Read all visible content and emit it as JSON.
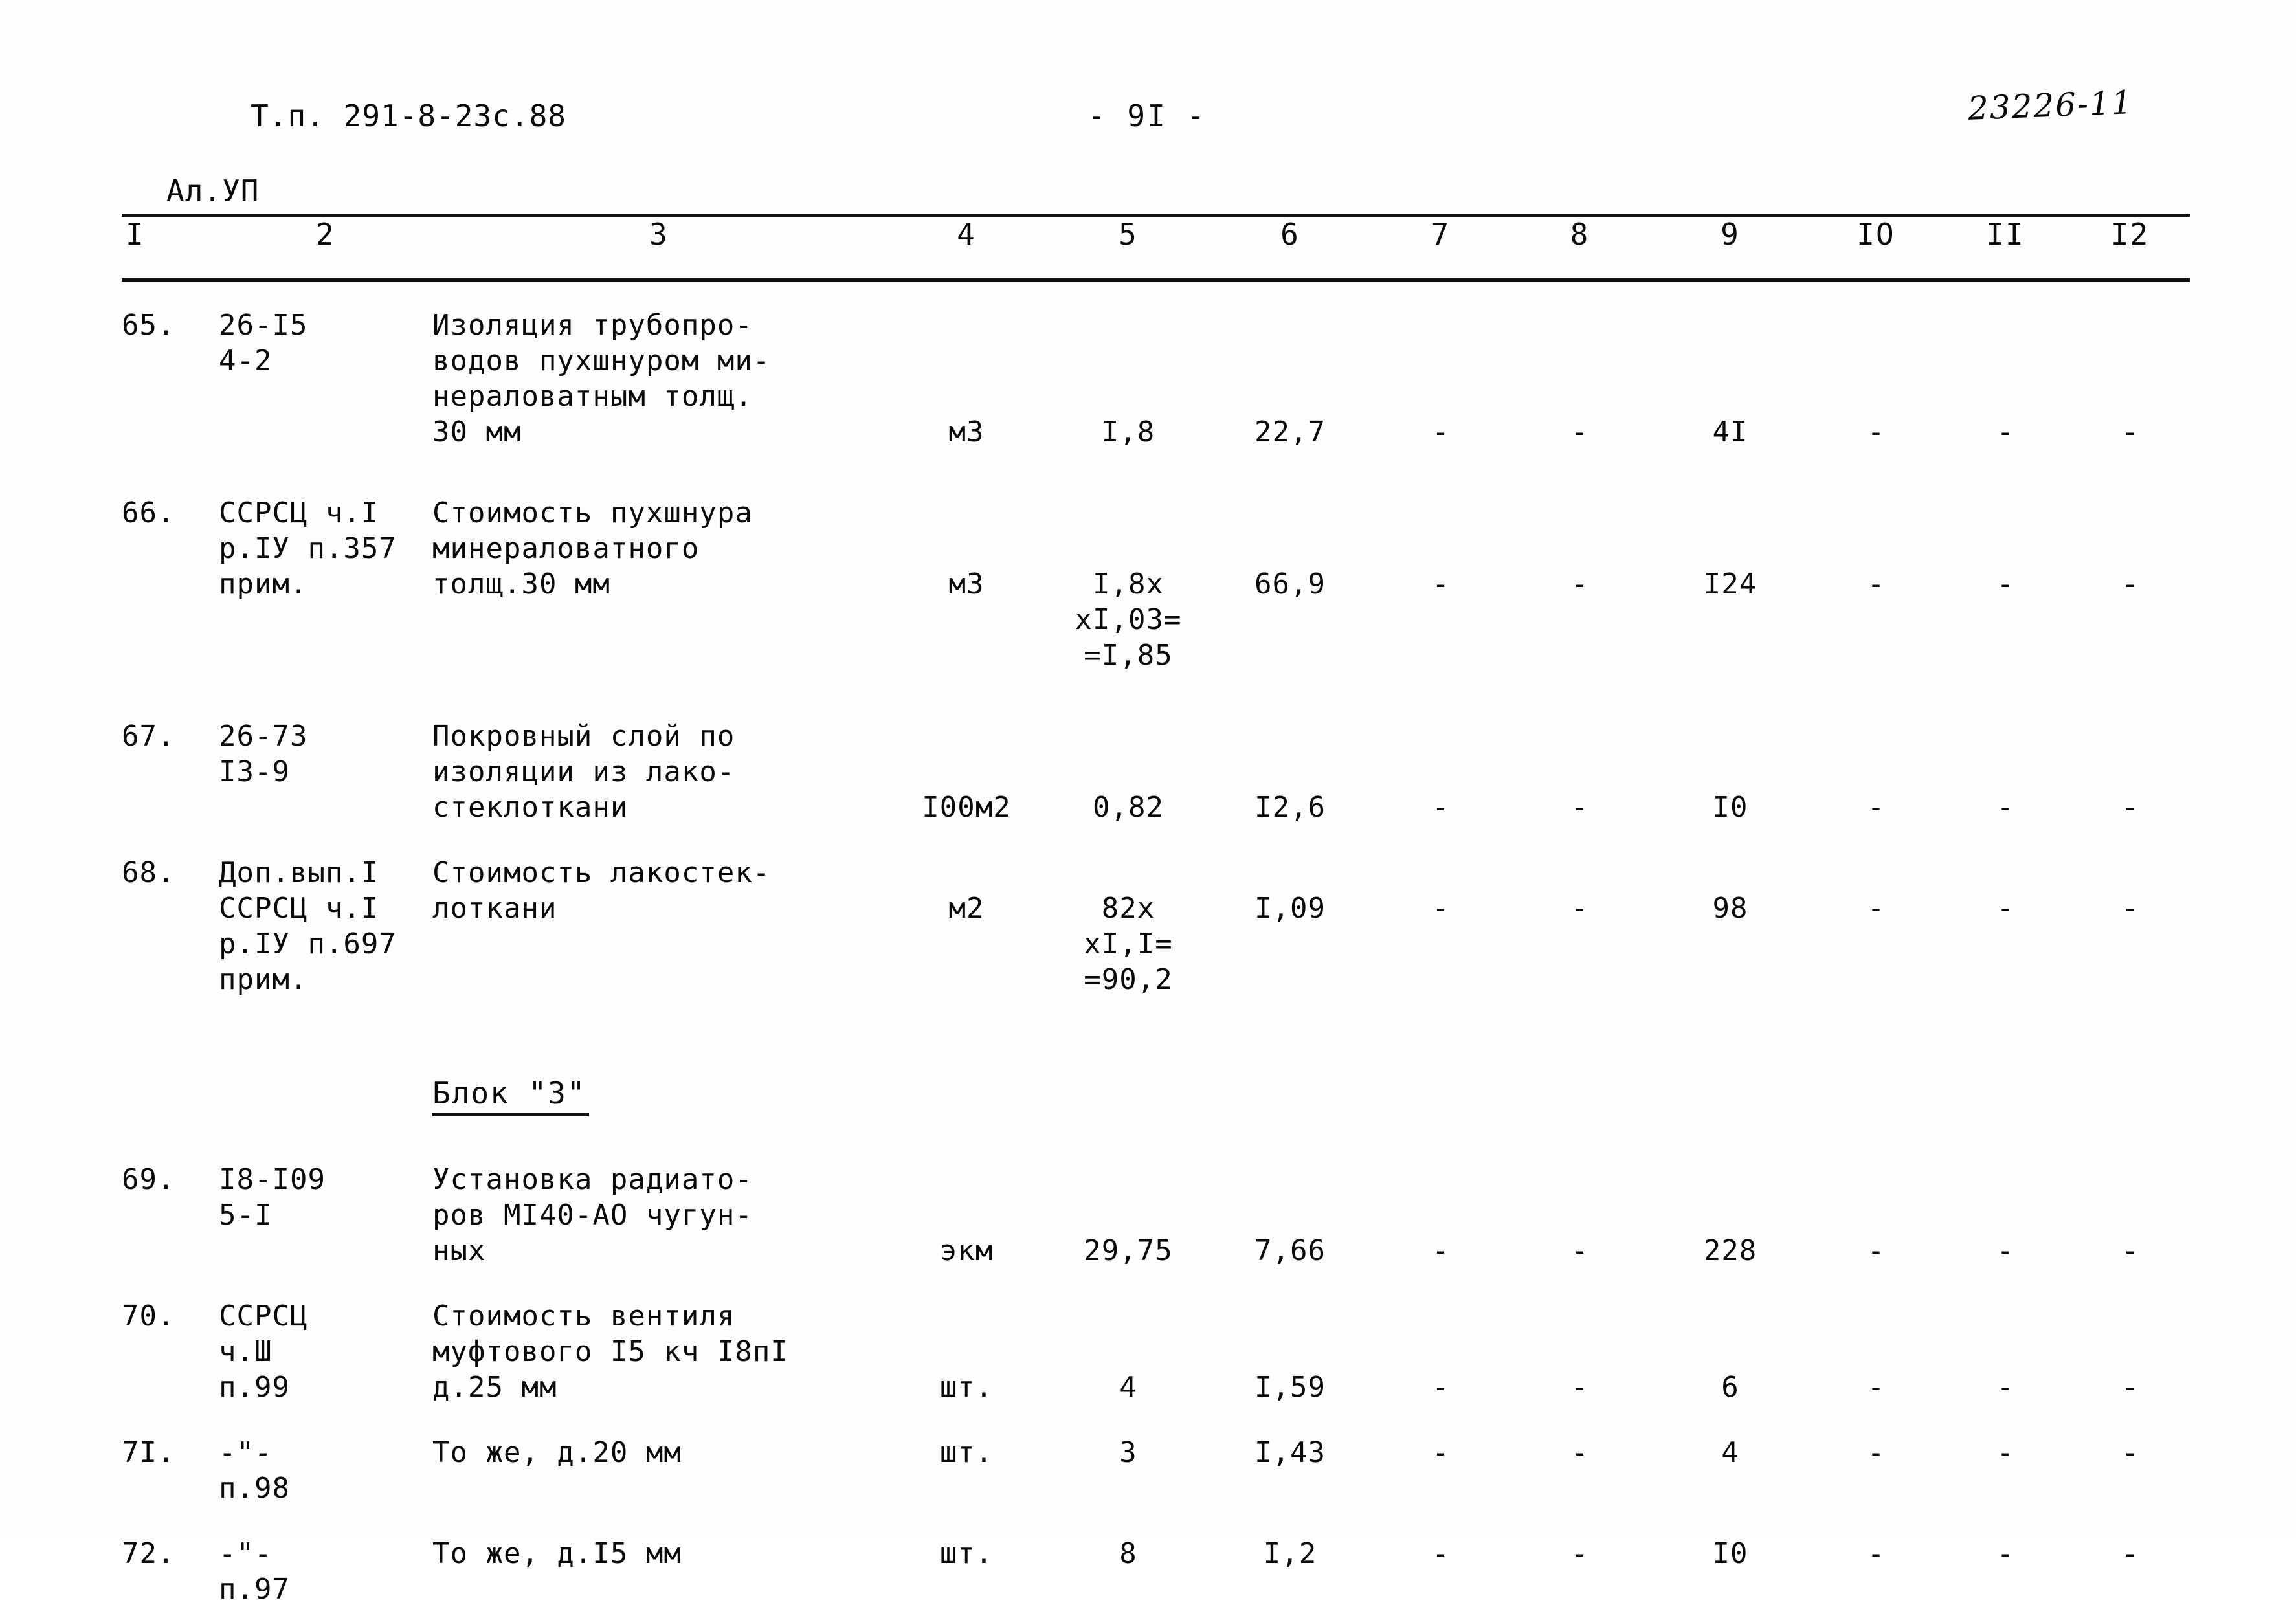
{
  "header": {
    "project_code_line1": "Т.п. 291-8-23с.88",
    "project_code_line2": "Ал.УП",
    "page_number": "- 9I -",
    "archive_code": "23226-11"
  },
  "table": {
    "column_headers": [
      "I",
      "2",
      "3",
      "4",
      "5",
      "6",
      "7",
      "8",
      "9",
      "IO",
      "II",
      "I2"
    ],
    "rows": [
      {
        "num": "65.",
        "code": "26-I5\n4-2",
        "desc": "Изоляция трубопро-\nводов пухшнуром ми-\nнераловатным толщ.\n30 мм",
        "unit": "м3",
        "c5": "I,8",
        "c6": "22,7",
        "c7": "-",
        "c8": "-",
        "c9": "4I",
        "c10": "-",
        "c11": "-",
        "c12": "-"
      },
      {
        "num": "66.",
        "code": "ССРСЦ ч.I\nр.IУ п.357\nприм.",
        "desc": "Стоимость пухшнура\nминераловатного\nтолщ.30 мм",
        "unit": "м3",
        "c5": "I,8х\nхI,03=\n=I,85",
        "c6": "66,9",
        "c7": "-",
        "c8": "-",
        "c9": "I24",
        "c10": "-",
        "c11": "-",
        "c12": "-"
      },
      {
        "num": "67.",
        "code": "26-73\nI3-9",
        "desc": "Покровный слой по\nизоляции из лако-\nстеклоткани",
        "unit": "I00м2",
        "c5": "0,82",
        "c6": "I2,6",
        "c7": "-",
        "c8": "-",
        "c9": "I0",
        "c10": "-",
        "c11": "-",
        "c12": "-"
      },
      {
        "num": "68.",
        "code": "Доп.вып.I\nССРСЦ ч.I\nр.IУ п.697\nприм.",
        "desc": "Стоимость лакостек-\nлоткани",
        "unit": "м2",
        "c5": "82х\nхI,I=\n=90,2",
        "c6": "I,09",
        "c7": "-",
        "c8": "-",
        "c9": "98",
        "c10": "-",
        "c11": "-",
        "c12": "-"
      },
      {
        "num": "69.",
        "code": "I8-I09\n5-I",
        "desc": "Установка радиато-\nров МI40-АО чугун-\nных",
        "unit": "экм",
        "c5": "29,75",
        "c6": "7,66",
        "c7": "-",
        "c8": "-",
        "c9": "228",
        "c10": "-",
        "c11": "-",
        "c12": "-"
      },
      {
        "num": "70.",
        "code": "ССРСЦ\nч.Ш\nп.99",
        "desc": "Стоимость вентиля\nмуфтового I5 кч I8пI\nд.25 мм",
        "unit": "шт.",
        "c5": "4",
        "c6": "I,59",
        "c7": "-",
        "c8": "-",
        "c9": "6",
        "c10": "-",
        "c11": "-",
        "c12": "-"
      },
      {
        "num": "7I.",
        "code": "-\"-\nп.98",
        "desc": "То же, д.20 мм",
        "unit": "шт.",
        "c5": "3",
        "c6": "I,43",
        "c7": "-",
        "c8": "-",
        "c9": "4",
        "c10": "-",
        "c11": "-",
        "c12": "-"
      },
      {
        "num": "72.",
        "code": "-\"-\nп.97",
        "desc": "То же, д.I5 мм",
        "unit": "шт.",
        "c5": "8",
        "c6": "I,2",
        "c7": "-",
        "c8": "-",
        "c9": "I0",
        "c10": "-",
        "c11": "-",
        "c12": "-"
      }
    ],
    "section_heading": "Блок \"З\""
  }
}
